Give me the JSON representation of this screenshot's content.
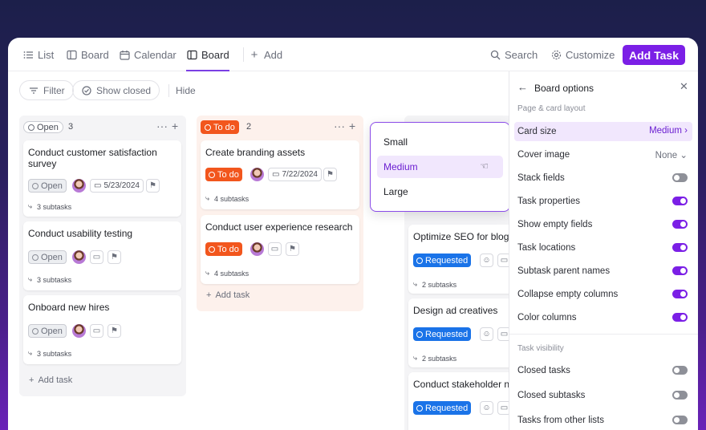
{
  "nav": {
    "tabs": [
      {
        "label": "List",
        "icon": "list-icon"
      },
      {
        "label": "Board",
        "icon": "board-icon"
      },
      {
        "label": "Calendar",
        "icon": "calendar-icon"
      },
      {
        "label": "Board",
        "icon": "board-icon",
        "active": true
      }
    ],
    "add_label": "Add",
    "search_label": "Search",
    "customize_label": "Customize",
    "add_task_label": "Add Task"
  },
  "toolbar": {
    "filter_label": "Filter",
    "show_closed_label": "Show closed",
    "hide_label": "Hide"
  },
  "columns": {
    "open": {
      "status": "Open",
      "count": "3",
      "cards": [
        {
          "title": "Conduct customer satisfaction survey",
          "status": "Open",
          "date": "5/23/2024",
          "subtasks": "3 subtasks"
        },
        {
          "title": "Conduct usability testing",
          "status": "Open",
          "subtasks": "3 subtasks"
        },
        {
          "title": "Onboard new hires",
          "status": "Open",
          "subtasks": "3 subtasks"
        }
      ],
      "add_task_label": "Add task"
    },
    "todo": {
      "status": "To do",
      "count": "2",
      "cards": [
        {
          "title": "Create branding assets",
          "status": "To do",
          "date": "7/22/2024",
          "subtasks": "4 subtasks"
        },
        {
          "title": "Conduct user experience research",
          "status": "To do",
          "subtasks": "4 subtasks"
        }
      ],
      "add_task_label": "Add task"
    },
    "requested": {
      "cards": [
        {
          "title": "Optimize SEO for blog",
          "status": "Requested",
          "subtasks": "2 subtasks"
        },
        {
          "title": "Design ad creatives",
          "status": "Requested",
          "subtasks": "2 subtasks"
        },
        {
          "title": "Conduct stakeholder n",
          "status": "Requested"
        }
      ]
    }
  },
  "card_size_dropdown": {
    "options": [
      "Small",
      "Medium",
      "Large"
    ],
    "selected": "Medium"
  },
  "board_options": {
    "title": "Board options",
    "section_layout": "Page & card layout",
    "card_size_label": "Card size",
    "card_size_value": "Medium",
    "cover_image_label": "Cover image",
    "cover_image_value": "None",
    "toggles": [
      {
        "label": "Stack fields",
        "on": false
      },
      {
        "label": "Task properties",
        "on": true
      },
      {
        "label": "Show empty fields",
        "on": true
      },
      {
        "label": "Task locations",
        "on": true
      },
      {
        "label": "Subtask parent names",
        "on": true
      },
      {
        "label": "Collapse empty columns",
        "on": true
      },
      {
        "label": "Color columns",
        "on": true
      }
    ],
    "section_visibility": "Task visibility",
    "visibility_toggles": [
      {
        "label": "Closed tasks",
        "on": false
      },
      {
        "label": "Closed subtasks",
        "on": false
      },
      {
        "label": "Tasks from other lists",
        "on": false
      }
    ]
  },
  "colors": {
    "accent": "#7b1fe6",
    "todo": "#f2561d",
    "requested": "#1a73e8"
  }
}
